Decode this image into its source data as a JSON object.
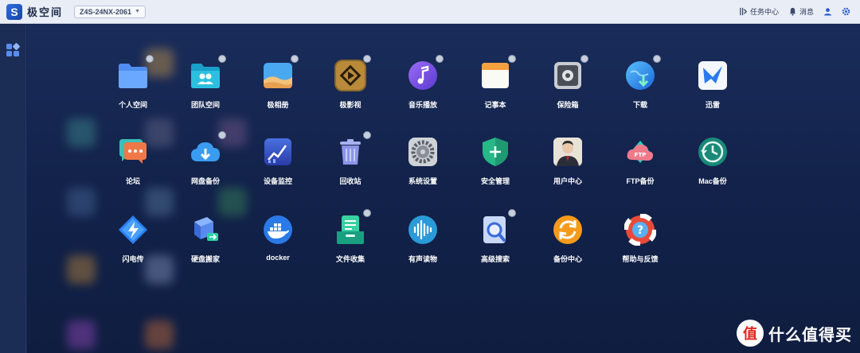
{
  "brand": {
    "logo_letter": "S",
    "name": "极空间"
  },
  "device": {
    "name": "Z4S-24NX-2061"
  },
  "topbar": {
    "task_center": "任务中心",
    "messages": "消息"
  },
  "apps": [
    {
      "label": "个人空间",
      "icon": "folder-icon"
    },
    {
      "label": "团队空间",
      "icon": "team-folder-icon"
    },
    {
      "label": "极相册",
      "icon": "photo-icon"
    },
    {
      "label": "极影视",
      "icon": "video-icon"
    },
    {
      "label": "音乐播放",
      "icon": "music-icon"
    },
    {
      "label": "记事本",
      "icon": "notebook-icon"
    },
    {
      "label": "保险箱",
      "icon": "safe-icon"
    },
    {
      "label": "下载",
      "icon": "download-icon"
    },
    {
      "label": "迅雷",
      "icon": "thunder-icon"
    },
    {
      "label": "论坛",
      "icon": "forum-icon"
    },
    {
      "label": "网盘备份",
      "icon": "cloud-backup-icon"
    },
    {
      "label": "设备监控",
      "icon": "monitor-icon"
    },
    {
      "label": "回收站",
      "icon": "trash-icon"
    },
    {
      "label": "系统设置",
      "icon": "settings-icon"
    },
    {
      "label": "安全管理",
      "icon": "shield-icon"
    },
    {
      "label": "用户中心",
      "icon": "user-icon"
    },
    {
      "label": "FTP备份",
      "icon": "ftp-icon"
    },
    {
      "label": "Mac备份",
      "icon": "time-machine-icon"
    },
    {
      "label": "闪电传",
      "icon": "lightning-icon"
    },
    {
      "label": "硬盘搬家",
      "icon": "disk-move-icon"
    },
    {
      "label": "docker",
      "icon": "docker-icon"
    },
    {
      "label": "文件收集",
      "icon": "file-collect-icon"
    },
    {
      "label": "有声读物",
      "icon": "audio-icon"
    },
    {
      "label": "高级搜索",
      "icon": "search-icon"
    },
    {
      "label": "备份中心",
      "icon": "backup-center-icon"
    },
    {
      "label": "帮助与反馈",
      "icon": "help-icon"
    }
  ],
  "watermark": {
    "glyph": "值",
    "text": "什么值得买"
  }
}
